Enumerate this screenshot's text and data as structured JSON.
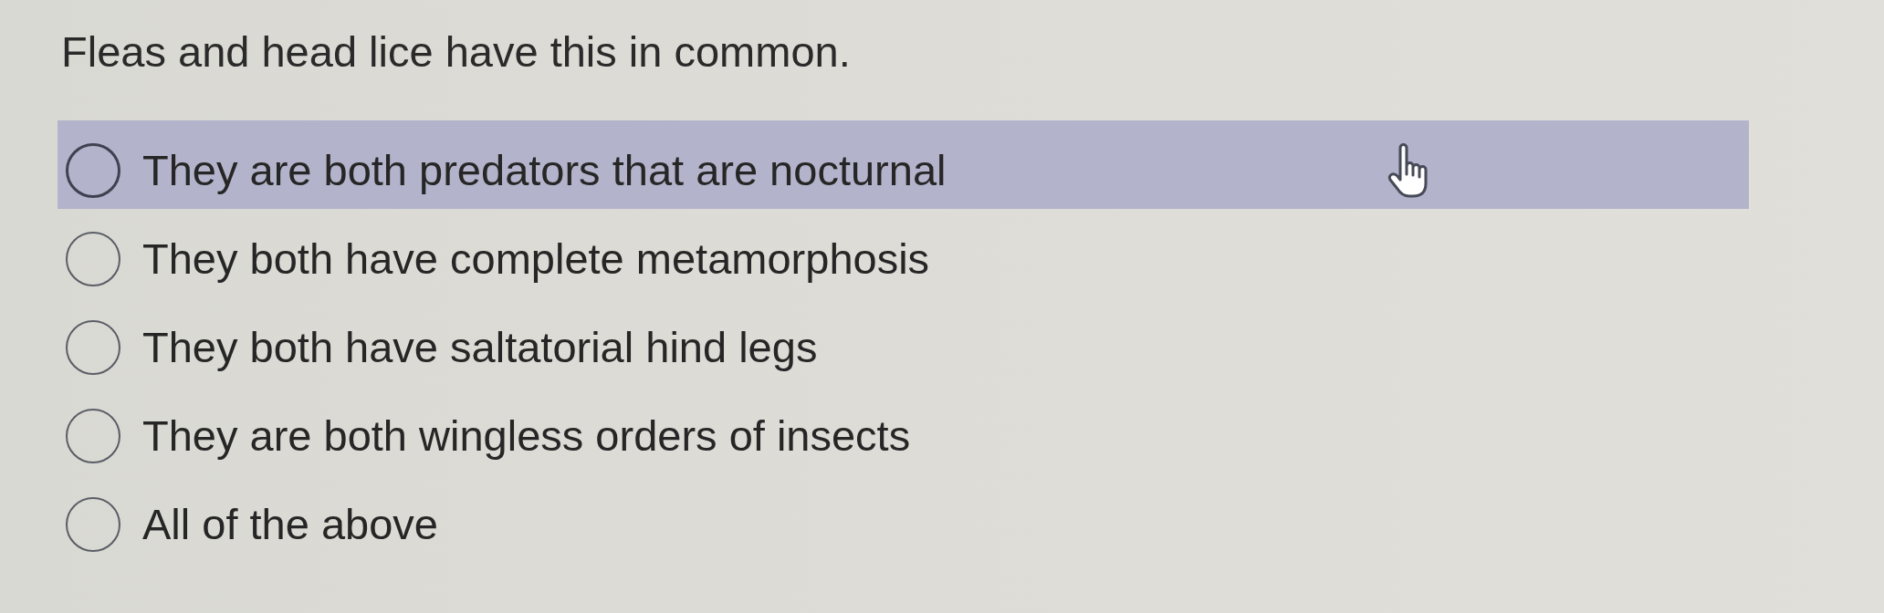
{
  "question": "Fleas and head lice have this in common.",
  "options": [
    {
      "label": "They are both predators that are nocturnal",
      "selected": false,
      "hovered": true
    },
    {
      "label": "They both have complete metamorphosis",
      "selected": false,
      "hovered": false
    },
    {
      "label": "They both have saltatorial hind legs",
      "selected": false,
      "hovered": false
    },
    {
      "label": "They are both wingless orders of insects",
      "selected": false,
      "hovered": false
    },
    {
      "label": "All of the above",
      "selected": false,
      "hovered": false
    }
  ]
}
